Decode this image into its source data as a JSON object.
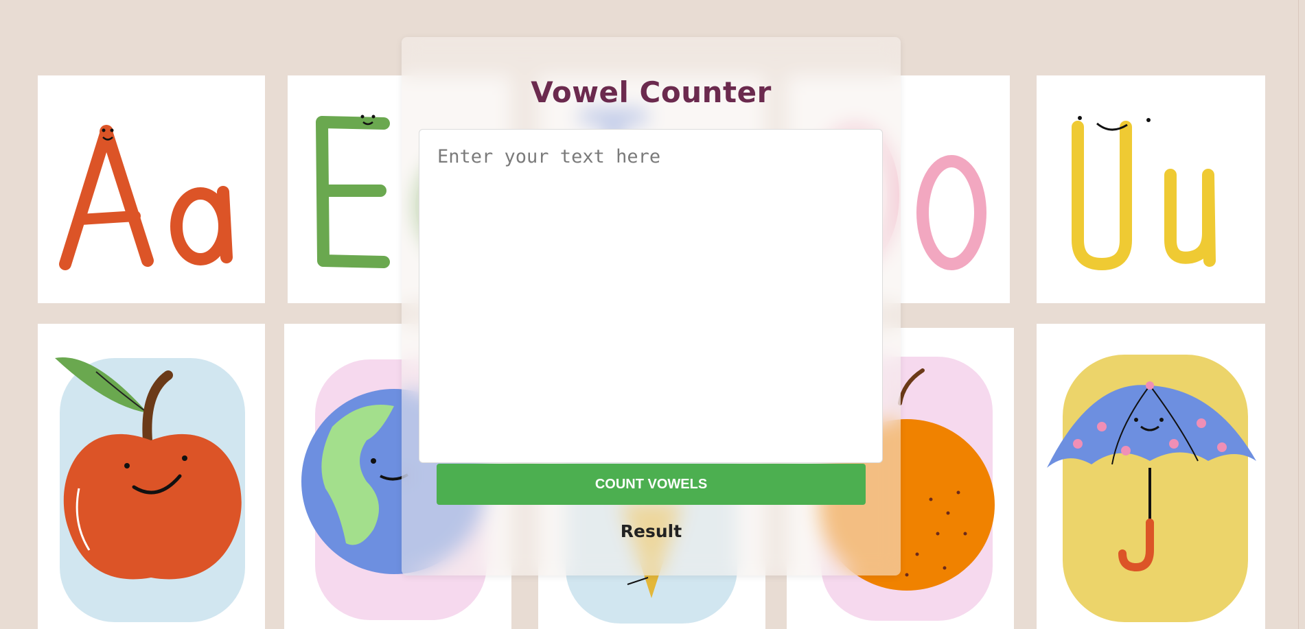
{
  "app": {
    "title": "Vowel Counter",
    "input_placeholder": "Enter your text here",
    "input_value": "",
    "button_label": "Count Vowels",
    "result_label": "Result"
  },
  "background_cards": {
    "letters": [
      "Aa",
      "Ee",
      "Ii",
      "Oo",
      "Uu"
    ],
    "pictures": [
      "apple-icon",
      "globe-icon",
      "ice-cream-icon",
      "orange-icon",
      "umbrella-icon"
    ]
  },
  "colors": {
    "page_bg": "#e8dcd3",
    "title": "#6b2a4e",
    "button": "#4caf50",
    "letter_a": "#dc5427",
    "letter_e": "#6aa84f",
    "letter_i": "#6d8fe0",
    "letter_o": "#f2a7c0",
    "letter_u": "#efca33"
  }
}
